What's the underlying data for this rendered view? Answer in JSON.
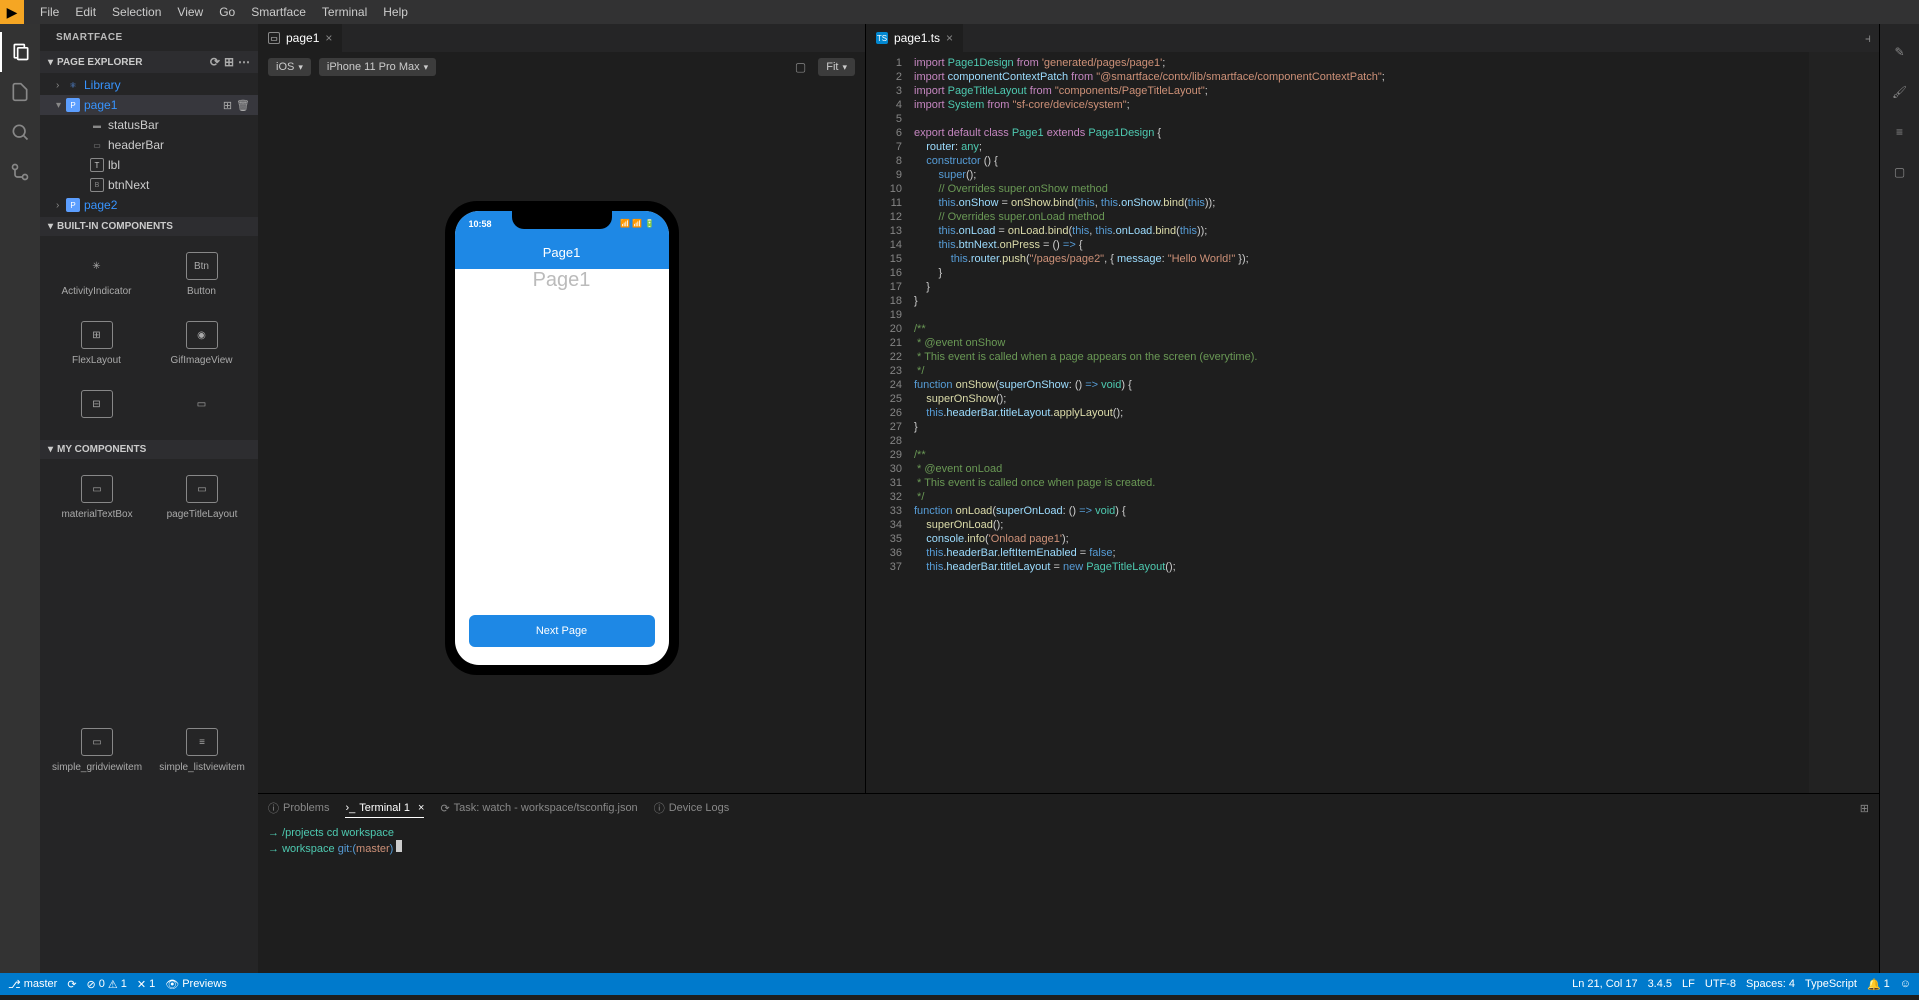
{
  "menu": [
    "File",
    "Edit",
    "Selection",
    "View",
    "Go",
    "Smartface",
    "Terminal",
    "Help"
  ],
  "sidebar": {
    "title": "SMARTFACE",
    "explorer": {
      "title": "PAGE EXPLORER",
      "library": "Library",
      "page1": "page1",
      "statusBar": "statusBar",
      "headerBar": "headerBar",
      "lbl": "lbl",
      "btnNext": "btnNext",
      "page2": "page2"
    },
    "builtin": {
      "title": "BUILT-IN COMPONENTS",
      "items": [
        "ActivityIndicator",
        "Button",
        "FlexLayout",
        "GifImageView"
      ]
    },
    "my": {
      "title": "MY COMPONENTS",
      "items": [
        "materialTextBox",
        "pageTitleLayout",
        "simple_gridviewitem",
        "simple_listviewitem"
      ]
    }
  },
  "tabs": {
    "designer": "page1",
    "code": "page1.ts"
  },
  "designer": {
    "os": "iOS",
    "device": "iPhone 11 Pro Max",
    "zoom": "Fit",
    "time": "10:58",
    "title": "Page1",
    "label": "Page1",
    "button": "Next Page"
  },
  "code": {
    "lines": [
      {
        "n": 1,
        "html": "<span class='k-import'>import</span> <span class='k-type'>Page1Design</span> <span class='k-import'>from</span> <span class='k-str'>'generated/pages/page1'</span>;"
      },
      {
        "n": 2,
        "html": "<span class='k-import'>import</span> <span class='k-prop'>componentContextPatch</span> <span class='k-import'>from</span> <span class='k-str'>\"@smartface/contx/lib/smartface/componentContextPatch\"</span>;"
      },
      {
        "n": 3,
        "html": "<span class='k-import'>import</span> <span class='k-type'>PageTitleLayout</span> <span class='k-import'>from</span> <span class='k-str'>\"components/PageTitleLayout\"</span>;"
      },
      {
        "n": 4,
        "html": "<span class='k-import'>import</span> <span class='k-type'>System</span> <span class='k-import'>from</span> <span class='k-str'>\"sf-core/device/system\"</span>;"
      },
      {
        "n": 5,
        "html": ""
      },
      {
        "n": 6,
        "html": "<span class='k-keyword'>export default class</span> <span class='k-type'>Page1</span> <span class='k-keyword'>extends</span> <span class='k-type'>Page1Design</span> {"
      },
      {
        "n": 7,
        "html": "    <span class='k-prop'>router</span>: <span class='k-type'>any</span>;"
      },
      {
        "n": 8,
        "html": "    <span class='k-const'>constructor</span> () {"
      },
      {
        "n": 9,
        "html": "        <span class='k-const'>super</span>();"
      },
      {
        "n": 10,
        "html": "        <span class='k-comment'>// Overrides super.onShow method</span>"
      },
      {
        "n": 11,
        "html": "        <span class='k-this'>this</span>.<span class='k-prop'>onShow</span> = <span class='k-fn'>onShow</span>.<span class='k-fn'>bind</span>(<span class='k-this'>this</span>, <span class='k-this'>this</span>.<span class='k-prop'>onShow</span>.<span class='k-fn'>bind</span>(<span class='k-this'>this</span>));"
      },
      {
        "n": 12,
        "html": "        <span class='k-comment'>// Overrides super.onLoad method</span>"
      },
      {
        "n": 13,
        "html": "        <span class='k-this'>this</span>.<span class='k-prop'>onLoad</span> = <span class='k-fn'>onLoad</span>.<span class='k-fn'>bind</span>(<span class='k-this'>this</span>, <span class='k-this'>this</span>.<span class='k-prop'>onLoad</span>.<span class='k-fn'>bind</span>(<span class='k-this'>this</span>));"
      },
      {
        "n": 14,
        "html": "        <span class='k-this'>this</span>.<span class='k-prop'>btnNext</span>.<span class='k-fn'>onPress</span> = () <span class='k-const'>=&gt;</span> {"
      },
      {
        "n": 15,
        "html": "            <span class='k-this'>this</span>.<span class='k-prop'>router</span>.<span class='k-fn'>push</span>(<span class='k-str'>\"/pages/page2\"</span>, { <span class='k-prop'>message</span>: <span class='k-str'>\"Hello World!\"</span> });"
      },
      {
        "n": 16,
        "html": "        }"
      },
      {
        "n": 17,
        "html": "    }"
      },
      {
        "n": 18,
        "html": "}"
      },
      {
        "n": 19,
        "html": ""
      },
      {
        "n": 20,
        "html": "<span class='k-comment'>/**</span>"
      },
      {
        "n": 21,
        "html": "<span class='k-comment'> * @event onShow</span>"
      },
      {
        "n": 22,
        "html": "<span class='k-comment'> * This event is called when a page appears on the screen (everytime).</span>"
      },
      {
        "n": 23,
        "html": "<span class='k-comment'> */</span>"
      },
      {
        "n": 24,
        "html": "<span class='k-const'>function</span> <span class='k-fn'>onShow</span>(<span class='k-prop'>superOnShow</span>: () <span class='k-const'>=&gt;</span> <span class='k-type'>void</span>) {"
      },
      {
        "n": 25,
        "html": "    <span class='k-fn'>superOnShow</span>();"
      },
      {
        "n": 26,
        "html": "    <span class='k-this'>this</span>.<span class='k-prop'>headerBar</span>.<span class='k-prop'>titleLayout</span>.<span class='k-fn'>applyLayout</span>();"
      },
      {
        "n": 27,
        "html": "}"
      },
      {
        "n": 28,
        "html": ""
      },
      {
        "n": 29,
        "html": "<span class='k-comment'>/**</span>"
      },
      {
        "n": 30,
        "html": "<span class='k-comment'> * @event onLoad</span>"
      },
      {
        "n": 31,
        "html": "<span class='k-comment'> * This event is called once when page is created.</span>"
      },
      {
        "n": 32,
        "html": "<span class='k-comment'> */</span>"
      },
      {
        "n": 33,
        "html": "<span class='k-const'>function</span> <span class='k-fn'>onLoad</span>(<span class='k-prop'>superOnLoad</span>: () <span class='k-const'>=&gt;</span> <span class='k-type'>void</span>) {"
      },
      {
        "n": 34,
        "html": "    <span class='k-fn'>superOnLoad</span>();"
      },
      {
        "n": 35,
        "html": "    <span class='k-prop'>console</span>.<span class='k-fn'>info</span>(<span class='k-str'>'Onload page1'</span>);"
      },
      {
        "n": 36,
        "html": "    <span class='k-this'>this</span>.<span class='k-prop'>headerBar</span>.<span class='k-prop'>leftItemEnabled</span> = <span class='k-const'>false</span>;"
      },
      {
        "n": 37,
        "html": "    <span class='k-this'>this</span>.<span class='k-prop'>headerBar</span>.<span class='k-prop'>titleLayout</span> = <span class='k-const'>new</span> <span class='k-type'>PageTitleLayout</span>();"
      }
    ]
  },
  "panel": {
    "problems": "Problems",
    "terminal": "Terminal 1",
    "task": "Task: watch - workspace/tsconfig.json",
    "logs": "Device Logs",
    "line1": "/projects cd workspace",
    "line2_path": "workspace",
    "line2_git": "git:(",
    "line2_branch": "master",
    "line2_close": ")"
  },
  "status": {
    "branch": "master",
    "errors": "0",
    "warnings": "1",
    "other": "1",
    "previews": "Previews",
    "cursor": "Ln 21, Col 17",
    "version": "3.4.5",
    "eol": "LF",
    "encoding": "UTF-8",
    "spaces": "Spaces: 4",
    "lang": "TypeScript",
    "notif": "1"
  }
}
